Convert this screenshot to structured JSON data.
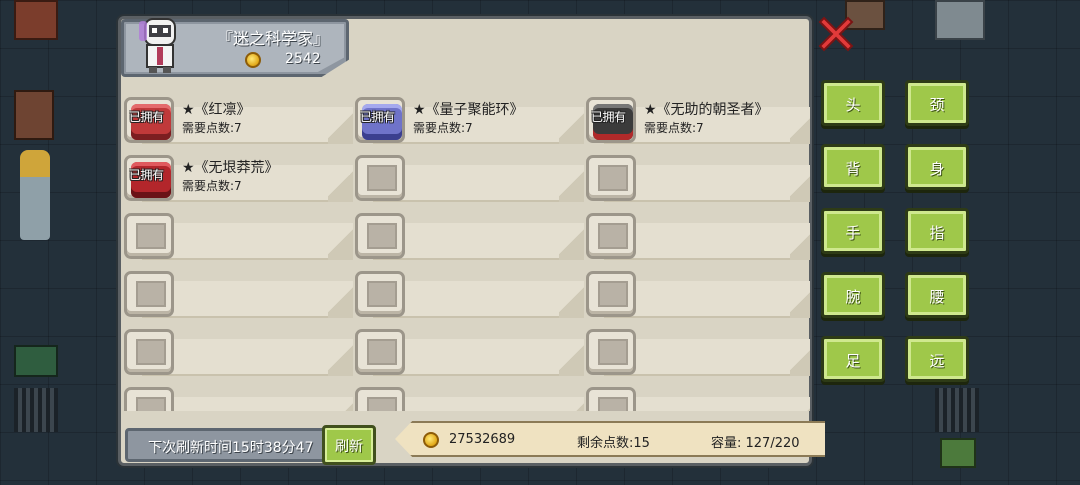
{
  "header": {
    "title": "『迷之科学家』",
    "coins": "2542"
  },
  "items": [
    {
      "name": "★《红凛》",
      "need": "需要点数:7",
      "owned": "已拥有",
      "color": "#c0393a"
    },
    {
      "name": "★《量子聚能环》",
      "need": "需要点数:7",
      "owned": "已拥有",
      "color": "#6f73c9"
    },
    {
      "name": "★《无助的朝圣者》",
      "need": "需要点数:7",
      "owned": "已拥有",
      "color": "#3b3b3b"
    },
    {
      "name": "★《无垠莽荒》",
      "need": "需要点数:7",
      "owned": "已拥有",
      "color": "#b3262b"
    }
  ],
  "footer": {
    "refresh_time": "下次刷新时间15时38分47",
    "refresh_button": "刷新",
    "gold": "27532689",
    "remaining": "剩余点数:15",
    "capacity": "容量:  127/220"
  },
  "categories": [
    "头",
    "颈",
    "背",
    "身",
    "手",
    "指",
    "腕",
    "腰",
    "足",
    "远"
  ],
  "icons": {
    "close": "close-x-icon",
    "coin": "coin-icon",
    "avatar": "scientist-avatar-icon"
  },
  "colors": {
    "accent_green": "#9fc84a",
    "panel": "#d9d4c4",
    "close_red": "#e23a3a"
  }
}
